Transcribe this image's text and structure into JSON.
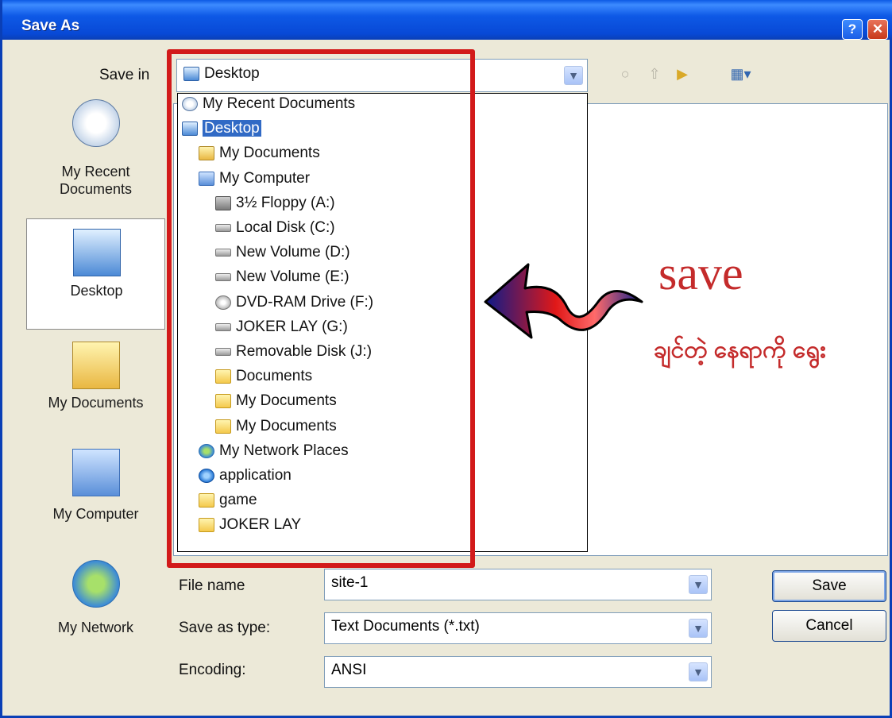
{
  "window": {
    "title": "Save As",
    "help_symbol": "?",
    "close_symbol": "✕"
  },
  "save_in": {
    "label": "Save in",
    "value": "Desktop"
  },
  "places_bar": [
    {
      "label_line1": "My Recent",
      "label_line2": "Documents",
      "icon": "recent-documents-icon"
    },
    {
      "label_line1": "Desktop",
      "label_line2": "",
      "icon": "desktop-icon"
    },
    {
      "label_line1": "My Documents",
      "label_line2": "",
      "icon": "my-documents-icon"
    },
    {
      "label_line1": "My Computer",
      "label_line2": "",
      "icon": "my-computer-icon"
    },
    {
      "label_line1": "My Network",
      "label_line2": "",
      "icon": "my-network-icon"
    }
  ],
  "dropdown_items": [
    {
      "label": "My Recent Documents",
      "icon": "recent",
      "indent": 0
    },
    {
      "label": "Desktop",
      "icon": "desk",
      "indent": 0,
      "selected": true
    },
    {
      "label": "My Documents",
      "icon": "mydoc",
      "indent": 1
    },
    {
      "label": "My Computer",
      "icon": "pc",
      "indent": 1
    },
    {
      "label": "3½ Floppy (A:)",
      "icon": "floppy",
      "indent": 2
    },
    {
      "label": "Local Disk (C:)",
      "icon": "drive",
      "indent": 2
    },
    {
      "label": "New Volume (D:)",
      "icon": "drive",
      "indent": 2
    },
    {
      "label": "New Volume (E:)",
      "icon": "drive",
      "indent": 2
    },
    {
      "label": "DVD-RAM Drive (F:)",
      "icon": "dvd",
      "indent": 2
    },
    {
      "label": "JOKER LAY (G:)",
      "icon": "drive",
      "indent": 2
    },
    {
      "label": "Removable Disk (J:)",
      "icon": "drive",
      "indent": 2
    },
    {
      "label": "Documents",
      "icon": "folder",
      "indent": 2
    },
    {
      "label": "My Documents",
      "icon": "folder",
      "indent": 2
    },
    {
      "label": "My Documents",
      "icon": "folder",
      "indent": 2
    },
    {
      "label": "My Network Places",
      "icon": "net",
      "indent": 1
    },
    {
      "label": "application",
      "icon": "ie",
      "indent": 1
    },
    {
      "label": "game",
      "icon": "folder",
      "indent": 1
    },
    {
      "label": "JOKER LAY",
      "icon": "folder",
      "indent": 1
    }
  ],
  "form": {
    "file_name_label": "File name",
    "file_name_value": "site-1",
    "save_as_type_label": "Save as type:",
    "save_as_type_value": "Text Documents (*.txt)",
    "encoding_label": "Encoding:",
    "encoding_value": "ANSI"
  },
  "buttons": {
    "save": "Save",
    "cancel": "Cancel"
  },
  "annotation": {
    "word": "save",
    "burmese_text": "ချင်တဲ့ နေရာကို ရွေး"
  },
  "colors": {
    "title_bar": "#0a4fd8",
    "highlight": "#d21a1a",
    "selection": "#316ac5"
  }
}
